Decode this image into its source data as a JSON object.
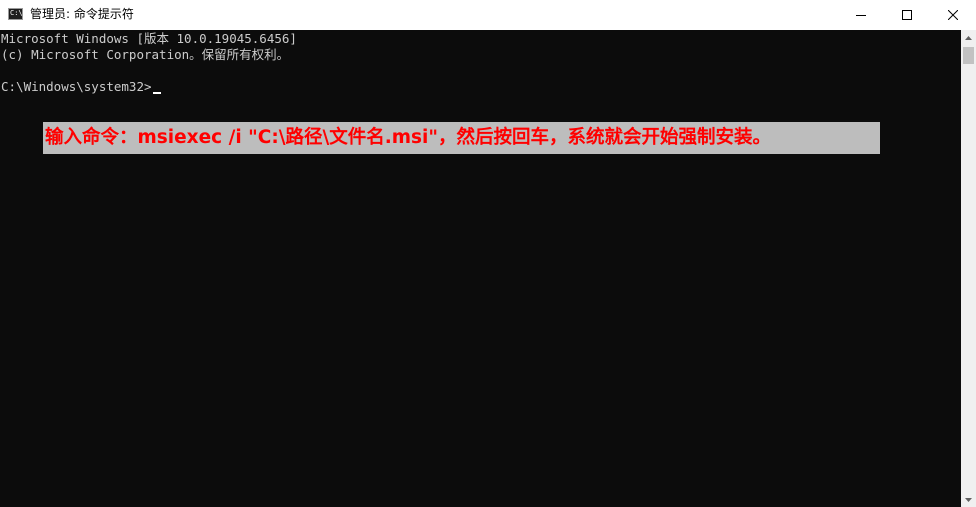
{
  "window": {
    "title": "管理员: 命令提示符",
    "icon_text": "C:\\"
  },
  "caption_buttons": {
    "minimize": "minimize-icon",
    "maximize": "maximize-icon",
    "close": "close-icon"
  },
  "console": {
    "lines": [
      "Microsoft Windows [版本 10.0.19045.6456]",
      "(c) Microsoft Corporation。保留所有权利。",
      "C:\\Windows\\system32>"
    ],
    "annotation": "输入命令：msiexec /i \"C:\\路径\\文件名.msi\"，然后按回车，系统就会开始强制安装。"
  },
  "colors": {
    "console_bg": "#0c0c0c",
    "console_text": "#cccccc",
    "annotation_text": "#ff0000",
    "annotation_bg": "#bdbdbd",
    "titlebar_bg": "#ffffff"
  }
}
